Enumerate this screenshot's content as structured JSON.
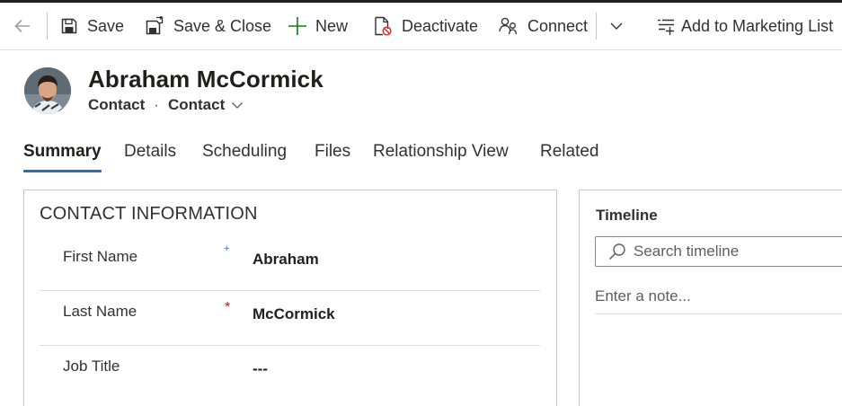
{
  "command_bar": {
    "back_icon": "arrow-left-icon",
    "items": [
      {
        "label": "Save",
        "icon": "save-icon"
      },
      {
        "label": "Save & Close",
        "icon": "save-close-icon"
      },
      {
        "label": "New",
        "icon": "plus-icon"
      },
      {
        "label": "Deactivate",
        "icon": "deactivate-icon"
      },
      {
        "label": "Connect",
        "icon": "connect-icon"
      },
      {
        "label": "",
        "icon": "chevron-down-icon"
      },
      {
        "label": "Add to Marketing List",
        "icon": "add-list-icon"
      }
    ]
  },
  "header": {
    "title": "Abraham McCormick",
    "entity": "Contact",
    "form": "Contact"
  },
  "tabs": [
    {
      "label": "Summary",
      "active": true
    },
    {
      "label": "Details",
      "active": false
    },
    {
      "label": "Scheduling",
      "active": false
    },
    {
      "label": "Files",
      "active": false
    },
    {
      "label": "Relationship View",
      "active": false
    },
    {
      "label": "Related",
      "active": false
    }
  ],
  "contact_info": {
    "title": "CONTACT INFORMATION",
    "fields": [
      {
        "label": "First Name",
        "required": "+",
        "value": "Abraham"
      },
      {
        "label": "Last Name",
        "required": "*",
        "value": "McCormick"
      },
      {
        "label": "Job Title",
        "required": "",
        "value": "---"
      }
    ]
  },
  "timeline": {
    "title": "Timeline",
    "search_placeholder": "Search timeline",
    "note_placeholder": "Enter a note..."
  },
  "colors": {
    "accent": "#2d6cb3",
    "required": "#a4262c",
    "new_icon": "#107c10",
    "deactivate_icon": "#d13438"
  }
}
